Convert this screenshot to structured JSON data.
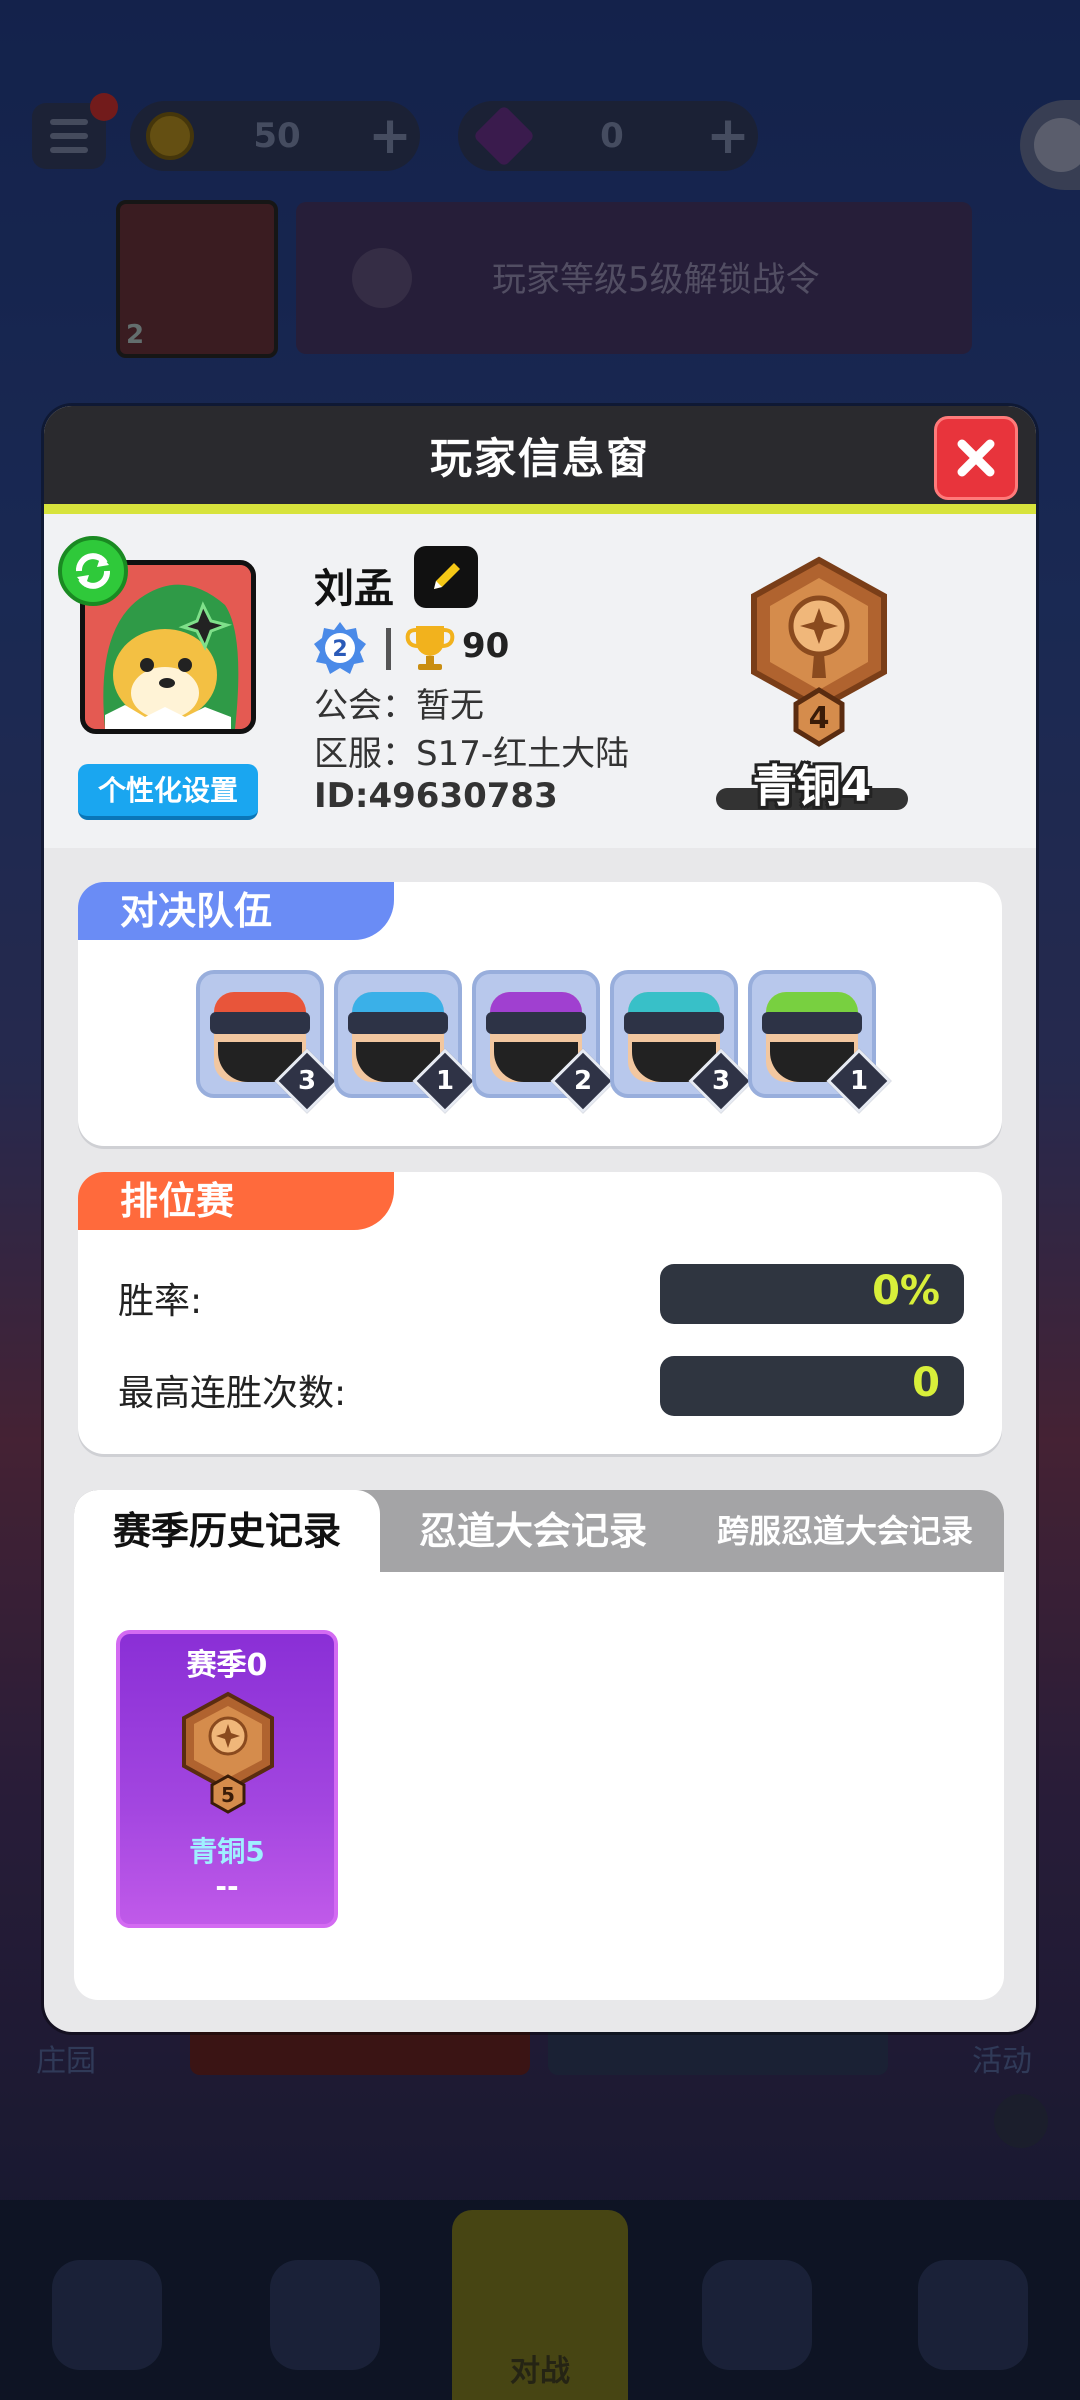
{
  "background": {
    "gold": "50",
    "gems": "0",
    "battlepass_level": "2",
    "battlepass_text": "玩家等级5级解锁战令",
    "left_label": "庄园",
    "right_label": "活动",
    "center_tab_label": "对战"
  },
  "modal": {
    "title": "玩家信息窗",
    "customize_label": "个性化设置",
    "player": {
      "name": "刘孟",
      "level": "2",
      "trophies": "90",
      "guild": "公会：暂无",
      "server": "区服：S17-红土大陆",
      "id": "ID:49630783"
    },
    "rank": {
      "tier": "4",
      "label": "青铜4"
    },
    "team": {
      "tab_label": "对决队伍",
      "heroes": [
        {
          "level": "3",
          "color": "#e8553a"
        },
        {
          "level": "1",
          "color": "#3ab0e8"
        },
        {
          "level": "2",
          "color": "#a040d0"
        },
        {
          "level": "3",
          "color": "#38c0c8"
        },
        {
          "level": "1",
          "color": "#78d040"
        }
      ]
    },
    "ranked": {
      "tab_label": "排位赛",
      "win_rate_label": "胜率:",
      "win_rate_value": "0%",
      "streak_label": "最高连胜次数:",
      "streak_value": "0"
    },
    "history": {
      "tabs": [
        "赛季历史记录",
        "忍道大会记录",
        "跨服忍道大会记录"
      ],
      "season_card": {
        "title": "赛季0",
        "tier": "5",
        "rank": "青铜5",
        "extra": "--"
      }
    }
  },
  "colors": {
    "team_tab": "#6a8cf5",
    "ranked_tab": "#ff6a3c",
    "close_button": "#e8343c",
    "stat_value": "#d8ef3a"
  }
}
